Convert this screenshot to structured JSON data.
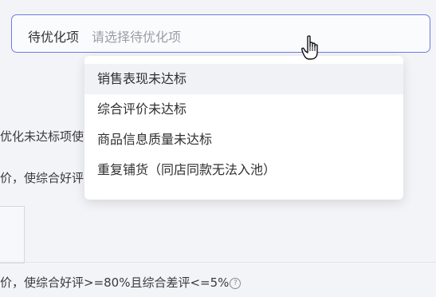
{
  "field": {
    "label": "待优化项",
    "placeholder": "请选择待优化项"
  },
  "background": {
    "line1": "优化未达标项使",
    "line2": "价，使综合好评",
    "line3": "价，使综合好评>=80%且综合差评<=5%",
    "help_glyph": "?"
  },
  "dropdown": {
    "items": [
      {
        "label": "销售表现未达标"
      },
      {
        "label": "综合评价未达标"
      },
      {
        "label": "商品信息质量未达标"
      },
      {
        "label": "重复铺货（同店同款无法入池）"
      }
    ]
  },
  "icons": {
    "cursor": "hand-pointer-icon",
    "help": "help-circle-icon"
  }
}
